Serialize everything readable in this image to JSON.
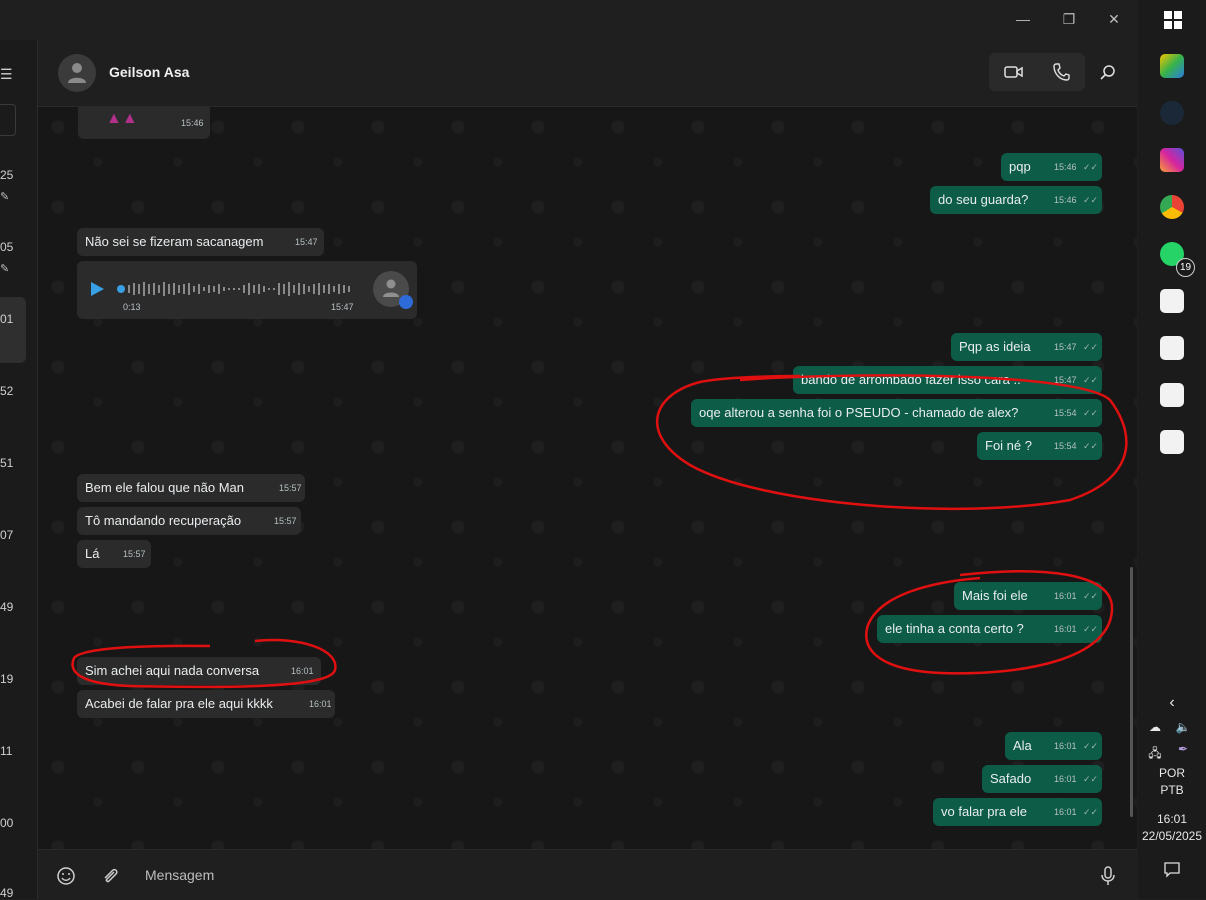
{
  "window": {
    "minimize_glyph": "—",
    "restore_glyph": "❐",
    "close_glyph": "✕"
  },
  "left_strip": {
    "numbers": [
      "25",
      "05",
      "01",
      "52",
      "51",
      "07",
      "49",
      "19",
      "11",
      "00",
      "49"
    ]
  },
  "header": {
    "contact_name": "Geilson Asa"
  },
  "composer": {
    "placeholder": "Mensagem"
  },
  "messages": [
    {
      "dir": "in",
      "text": "",
      "time": "15:46"
    },
    {
      "dir": "out",
      "text": "pqp",
      "time": "15:46"
    },
    {
      "dir": "out",
      "text": "do seu guarda?",
      "time": "15:46"
    },
    {
      "dir": "in",
      "text": "Não sei se fizeram sacanagem",
      "time": "15:47"
    },
    {
      "dir": "in",
      "type": "voice",
      "duration": "0:13",
      "time": "15:47"
    },
    {
      "dir": "out",
      "text": "Pqp as ideia",
      "time": "15:47"
    },
    {
      "dir": "out",
      "text": "bando de arrombado fazer isso cara ..",
      "time": "15:47"
    },
    {
      "dir": "out",
      "text": "oqe alterou a senha foi o PSEUDO - chamado de alex?",
      "time": "15:54"
    },
    {
      "dir": "out",
      "text": "Foi né ?",
      "time": "15:54"
    },
    {
      "dir": "in",
      "text": "Bem ele falou que não Man",
      "time": "15:57"
    },
    {
      "dir": "in",
      "text": "Tô mandando recuperação",
      "time": "15:57"
    },
    {
      "dir": "in",
      "text": "Lá",
      "time": "15:57"
    },
    {
      "dir": "out",
      "text": "Mais foi ele",
      "time": "16:01"
    },
    {
      "dir": "out",
      "text": "ele tinha a conta certo ?",
      "time": "16:01"
    },
    {
      "dir": "in",
      "text": "Sim achei aqui nada conversa",
      "time": "16:01"
    },
    {
      "dir": "in",
      "text": "Acabei de falar pra ele aqui kkkk",
      "time": "16:01"
    },
    {
      "dir": "out",
      "text": "Ala",
      "time": "16:01"
    },
    {
      "dir": "out",
      "text": "Safado",
      "time": "16:01"
    },
    {
      "dir": "out",
      "text": "vo falar pra ele",
      "time": "16:01"
    }
  ],
  "taskbar": {
    "whatsapp_badge": "19",
    "lang_line1": "POR",
    "lang_line2": "PTB",
    "clock_time": "16:01",
    "clock_date": "22/05/2025"
  },
  "colors": {
    "outgoing": "#0c5c48",
    "incoming": "#2b2b2b",
    "annotation": "#e01010"
  }
}
